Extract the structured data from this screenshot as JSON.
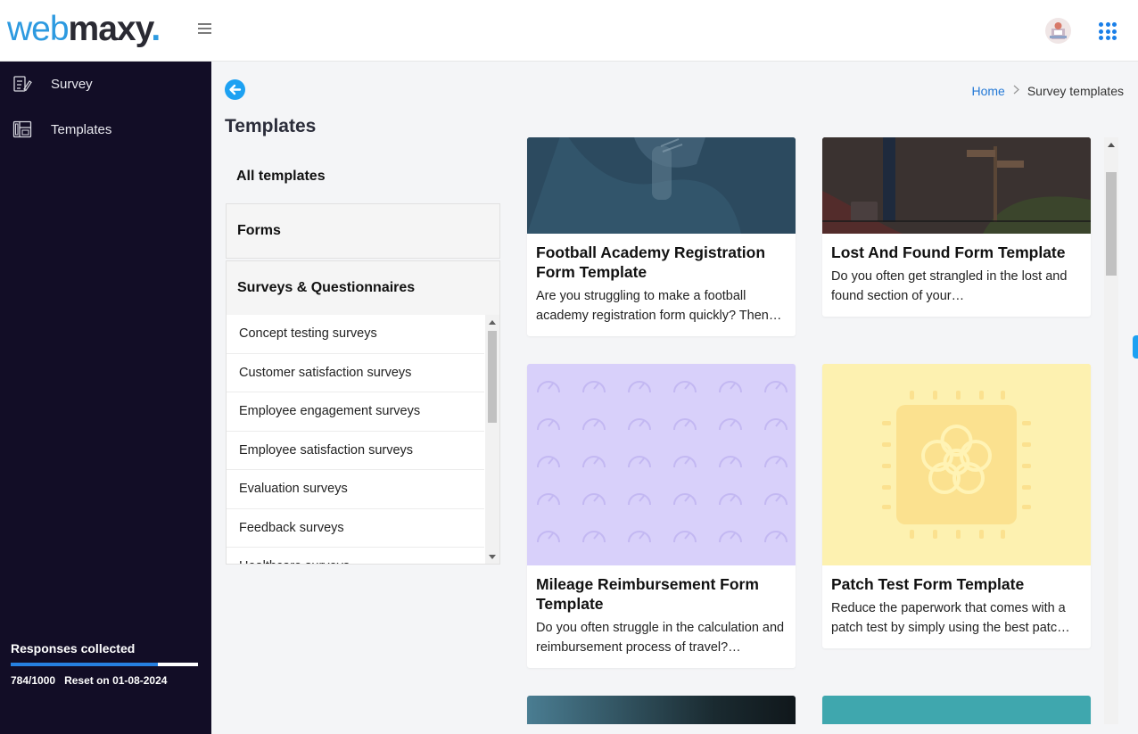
{
  "brand": {
    "part1": "web",
    "part2": "maxy",
    "part3": "."
  },
  "sidebar": {
    "items": [
      {
        "label": "Survey",
        "icon": "survey-icon"
      },
      {
        "label": "Templates",
        "icon": "templates-icon"
      }
    ],
    "responses": {
      "title": "Responses collected",
      "count": "784/1000",
      "used": 784,
      "limit": 1000,
      "reset": "Reset on 01-08-2024"
    }
  },
  "breadcrumb": {
    "home": "Home",
    "current": "Survey templates"
  },
  "page": {
    "title": "Templates"
  },
  "categories": {
    "all": "All templates",
    "forms": "Forms",
    "surveys": "Surveys & Questionnaires",
    "sub_items": [
      "Concept testing surveys",
      "Customer satisfaction surveys",
      "Employee engagement surveys",
      "Employee satisfaction surveys",
      "Evaluation surveys",
      "Feedback surveys",
      "Healthcare surveys"
    ]
  },
  "cards": [
    {
      "title": "Football Academy Registration Form Template",
      "desc": "Are you struggling to make a football academy registration form quickly? Then…",
      "image_color": "#2c4a5f"
    },
    {
      "title": "Lost And Found Form Template",
      "desc": "Do you often get strangled in the lost and found section of your…",
      "image_color": "#3a3230"
    },
    {
      "title": "Mileage Reimbursement Form Template",
      "desc": "Do you often struggle in the calculation and reimbursement process of travel?…",
      "image_color": "#d8d0fa"
    },
    {
      "title": "Patch Test Form Template",
      "desc": "Reduce the paperwork that comes with a patch test by simply using the best patc…",
      "image_color": "#fdf1b0"
    }
  ],
  "colors": {
    "sidebar_bg": "#120d26",
    "accent": "#1da1f2",
    "progress": "#2680e0"
  }
}
